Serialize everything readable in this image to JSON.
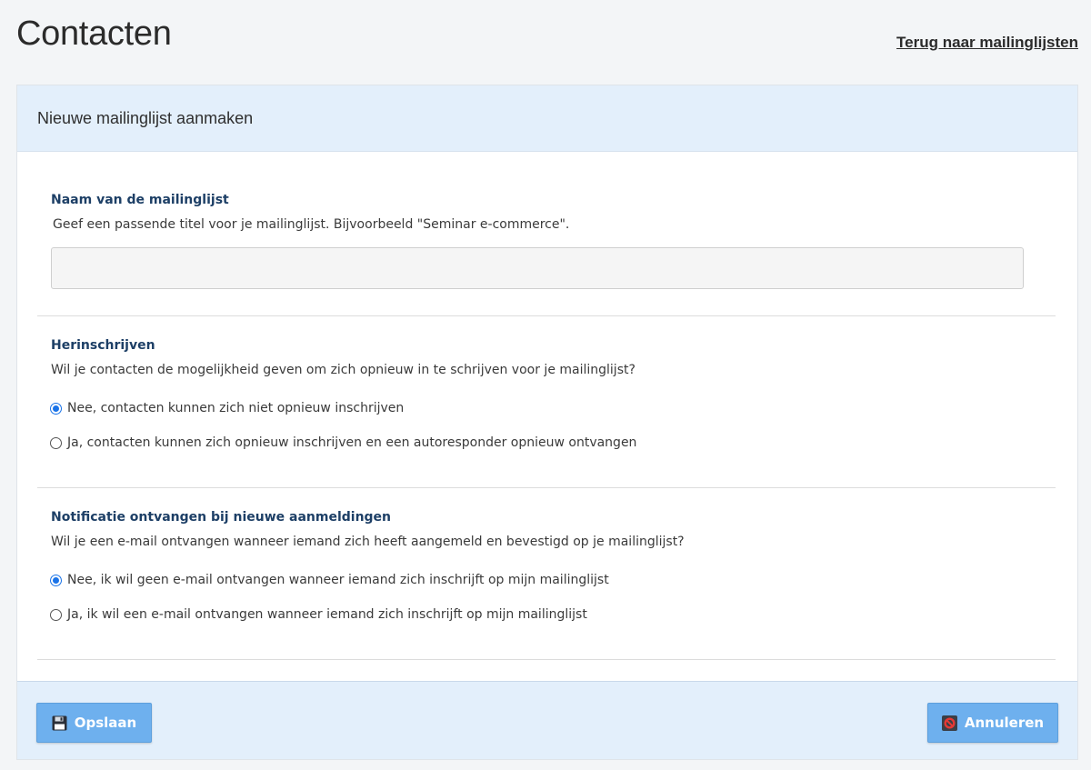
{
  "header": {
    "title": "Contacten",
    "back_link": "Terug naar mailinglijsten"
  },
  "panel": {
    "title": "Nieuwe mailinglijst aanmaken"
  },
  "name_section": {
    "label": "Naam van de mailinglijst",
    "description": "Geef een passende titel voor je mailinglijst. Bijvoorbeeld \"Seminar e-commerce\".",
    "value": "",
    "placeholder": ""
  },
  "resubscribe_section": {
    "label": "Herinschrijven",
    "question": "Wil je contacten de mogelijkheid geven om zich opnieuw in te schrijven voor je mailinglijst?",
    "options": [
      {
        "label": "Nee, contacten kunnen zich niet opnieuw inschrijven",
        "checked": true
      },
      {
        "label": "Ja, contacten kunnen zich opnieuw inschrijven en een autoresponder opnieuw ontvangen",
        "checked": false
      }
    ]
  },
  "notification_section": {
    "label": "Notificatie ontvangen bij nieuwe aanmeldingen",
    "question": "Wil je een e-mail ontvangen wanneer iemand zich heeft aangemeld en bevestigd op je mailinglijst?",
    "options": [
      {
        "label": "Nee, ik wil geen e-mail ontvangen wanneer iemand zich inschrijft op mijn mailinglijst",
        "checked": true
      },
      {
        "label": "Ja, ik wil een e-mail ontvangen wanneer iemand zich inschrijft op mijn mailinglijst",
        "checked": false
      }
    ]
  },
  "footer": {
    "save_label": "Opslaan",
    "cancel_label": "Annuleren",
    "save_icon": "floppy-disk-icon",
    "cancel_icon": "no-entry-icon"
  },
  "colors": {
    "accent": "#1a73e8",
    "button": "#6eb0ee",
    "header_bg": "#e3effb",
    "section_title": "#1d3f66"
  }
}
